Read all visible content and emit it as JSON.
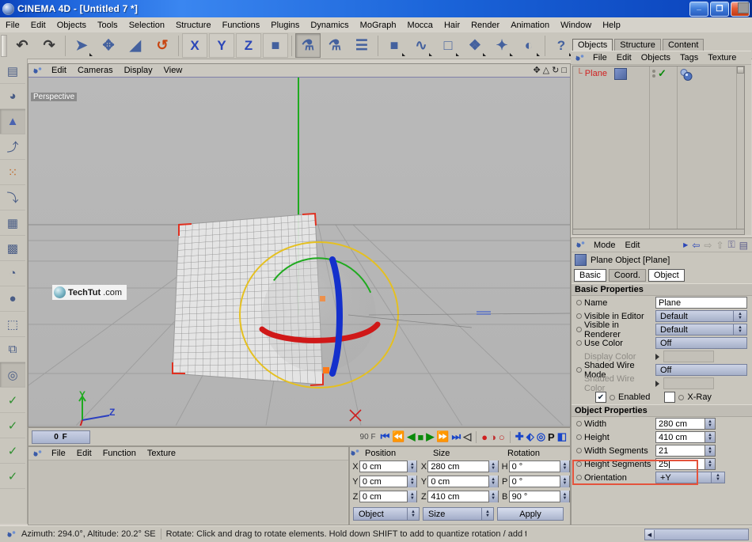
{
  "window": {
    "title": "CINEMA 4D - [Untitled 7 *]",
    "app_icon": "c4d-sphere-icon",
    "minimize": "_",
    "maximize": "❐",
    "close": "✕"
  },
  "menubar": {
    "items": [
      "File",
      "Edit",
      "Objects",
      "Tools",
      "Selection",
      "Structure",
      "Functions",
      "Plugins",
      "Dynamics",
      "MoGraph",
      "Mocca",
      "Hair",
      "Render",
      "Animation",
      "Window",
      "Help"
    ]
  },
  "toolbar": {
    "buttons": [
      {
        "name": "undo-icon",
        "glyph": "↶"
      },
      {
        "name": "redo-icon",
        "glyph": "↷"
      },
      {
        "name": "select-tool-icon",
        "glyph": "➤"
      },
      {
        "name": "move-tool-icon",
        "glyph": "✥"
      },
      {
        "name": "scale-tool-icon",
        "glyph": "◢"
      },
      {
        "name": "rotate-tool-icon",
        "glyph": "↺"
      },
      {
        "name": "x-axis-lock-icon",
        "glyph": "X"
      },
      {
        "name": "y-axis-lock-icon",
        "glyph": "Y"
      },
      {
        "name": "z-axis-lock-icon",
        "glyph": "Z"
      },
      {
        "name": "world-object-coords-icon",
        "glyph": "■"
      },
      {
        "name": "render-view-icon",
        "glyph": "⚗"
      },
      {
        "name": "render-region-icon",
        "glyph": "⚗"
      },
      {
        "name": "render-settings-icon",
        "glyph": "☰"
      },
      {
        "name": "add-cube-primitive-icon",
        "glyph": "■"
      },
      {
        "name": "add-spline-icon",
        "glyph": "∿"
      },
      {
        "name": "add-hypernurbs-icon",
        "glyph": "□"
      },
      {
        "name": "add-array-icon",
        "glyph": "❖"
      },
      {
        "name": "add-deformer-icon",
        "glyph": "✦"
      },
      {
        "name": "add-light-icon",
        "glyph": "◐"
      },
      {
        "name": "help-cursor-icon",
        "glyph": "?"
      },
      {
        "name": "script-help-icon",
        "glyph": "?"
      }
    ]
  },
  "left_toolbar": {
    "buttons": [
      {
        "name": "layout-manager-icon",
        "glyph": "▤"
      },
      {
        "name": "object-axis-modes-icon",
        "glyph": "◕"
      },
      {
        "name": "model-mode-icon",
        "glyph": "▲"
      },
      {
        "name": "object-axis-icon",
        "glyph": "⤴"
      },
      {
        "name": "point-mode-icon",
        "glyph": "⁙"
      },
      {
        "name": "edge-mode-icon",
        "glyph": "⤵"
      },
      {
        "name": "polygon-mode-icon",
        "glyph": "▦"
      },
      {
        "name": "texture-mode-icon",
        "glyph": "▩"
      },
      {
        "name": "texture-axis-icon",
        "glyph": "◔"
      },
      {
        "name": "viewport-solo-icon",
        "glyph": "●"
      },
      {
        "name": "enable-axis-icon",
        "glyph": "⬚"
      },
      {
        "name": "animation-lock-icon",
        "glyph": "⧉"
      },
      {
        "name": "uv-tools-icon",
        "glyph": "◎"
      },
      {
        "name": "quantize-toggle-icon",
        "glyph": "✓"
      },
      {
        "name": "texture-lock-icon",
        "glyph": "✓"
      },
      {
        "name": "viewport-clip-icon",
        "glyph": "✓"
      },
      {
        "name": "particle-toggle-icon",
        "glyph": "✓"
      }
    ]
  },
  "viewport": {
    "menu": [
      "Edit",
      "Cameras",
      "Display",
      "View"
    ],
    "label": "Perspective",
    "corner_icons": [
      {
        "name": "pan-view-icon",
        "glyph": "✥"
      },
      {
        "name": "zoom-view-icon",
        "glyph": "△"
      },
      {
        "name": "rotate-view-icon",
        "glyph": "↻"
      },
      {
        "name": "maximize-view-icon",
        "glyph": "□"
      }
    ],
    "axis_gizmo": {
      "y": "Y",
      "z": "Z",
      "x": "X"
    },
    "watermark": {
      "logo": "T",
      "name": "TechTut",
      "suffix": ".com"
    }
  },
  "timeline": {
    "current_frame": "0 F",
    "end_frame": "90 F",
    "controls": [
      {
        "name": "go-to-start-button",
        "glyph": "⏮"
      },
      {
        "name": "previous-key-button",
        "glyph": "⏪"
      },
      {
        "name": "play-reverse-button",
        "glyph": "◀"
      },
      {
        "name": "stop-button",
        "glyph": "■"
      },
      {
        "name": "play-forward-button",
        "glyph": "▶"
      },
      {
        "name": "next-key-button",
        "glyph": "⏩"
      },
      {
        "name": "go-to-end-button",
        "glyph": "⏭"
      },
      {
        "name": "sound-toggle-button",
        "glyph": "◁"
      },
      {
        "name": "record-button",
        "glyph": "●"
      },
      {
        "name": "autokey-button",
        "glyph": "◑"
      },
      {
        "name": "keyframe-selection-button",
        "glyph": "○"
      },
      {
        "name": "record-position-button",
        "glyph": "✚"
      },
      {
        "name": "record-scale-button",
        "glyph": "⬖"
      },
      {
        "name": "record-rotation-button",
        "glyph": "◎"
      },
      {
        "name": "record-pla-button",
        "glyph": "P"
      },
      {
        "name": "record-parameter-button",
        "glyph": "◧"
      }
    ]
  },
  "material_manager": {
    "menu": [
      "File",
      "Edit",
      "Function",
      "Texture"
    ],
    "materials": []
  },
  "coordinate_manager": {
    "headers": {
      "position": "Position",
      "size": "Size",
      "rotation": "Rotation"
    },
    "position": [
      {
        "axis": "X",
        "value": "0 cm"
      },
      {
        "axis": "Y",
        "value": "0 cm"
      },
      {
        "axis": "Z",
        "value": "0 cm"
      }
    ],
    "size": [
      {
        "axis": "X",
        "value": "280 cm"
      },
      {
        "axis": "Y",
        "value": "0 cm"
      },
      {
        "axis": "Z",
        "value": "410 cm"
      }
    ],
    "rotation": [
      {
        "axis": "H",
        "value": "0 °"
      },
      {
        "axis": "P",
        "value": "0 °"
      },
      {
        "axis": "B",
        "value": "90 °"
      }
    ],
    "mode_left": "Object",
    "mode_mid": "Size",
    "apply_label": "Apply"
  },
  "object_manager": {
    "tabs": [
      {
        "label": "Objects",
        "active": true
      },
      {
        "label": "Structure",
        "active": false
      },
      {
        "label": "Content",
        "active": false
      }
    ],
    "menu": [
      "File",
      "Edit",
      "Objects",
      "Tags",
      "Texture"
    ],
    "rows": [
      {
        "name": "Plane",
        "visible_editor": "✓",
        "tag": "phong-tag-icon"
      }
    ]
  },
  "attribute_manager": {
    "menu": [
      "Mode",
      "Edit"
    ],
    "nav_icons": [
      {
        "name": "history-forward-icon",
        "glyph": "▶"
      },
      {
        "name": "history-back-icon",
        "glyph": "⇦"
      },
      {
        "name": "history-next-icon",
        "glyph": "⇨"
      },
      {
        "name": "go-up-icon",
        "glyph": "⇧"
      },
      {
        "name": "lock-icon",
        "glyph": "⚿"
      },
      {
        "name": "panel-layout-icon",
        "glyph": "▤"
      }
    ],
    "object_title": "Plane Object [Plane]",
    "tabs": [
      {
        "label": "Basic",
        "active": true
      },
      {
        "label": "Coord.",
        "active": false
      },
      {
        "label": "Object",
        "active": true
      }
    ],
    "basic_section": "Basic Properties",
    "basic_rows": [
      {
        "label": "Name",
        "type": "text",
        "value": "Plane",
        "dim": false
      },
      {
        "label": "Visible in Editor",
        "type": "combo",
        "value": "Default",
        "dim": false
      },
      {
        "label": "Visible in Renderer",
        "type": "combo",
        "value": "Default",
        "dim": false
      },
      {
        "label": "Use Color",
        "type": "flat",
        "value": "Off",
        "dim": false
      },
      {
        "label": "Display Color",
        "type": "grey",
        "value": "",
        "dim": true
      },
      {
        "label": "Shaded Wire Mode",
        "type": "flat",
        "value": "Off",
        "dim": false
      },
      {
        "label": "Shaded Wire Color",
        "type": "grey",
        "value": "",
        "dim": true
      }
    ],
    "checkboxes": [
      {
        "label": "Enabled",
        "checked": true
      },
      {
        "label": "X-Ray",
        "checked": false
      }
    ],
    "object_section": "Object Properties",
    "object_rows": [
      {
        "label": "Width",
        "type": "num",
        "value": "280 cm",
        "highlighted": false
      },
      {
        "label": "Height",
        "type": "num",
        "value": "410 cm",
        "highlighted": false
      },
      {
        "label": "Width Segments",
        "type": "num",
        "value": "21",
        "highlighted": true
      },
      {
        "label": "Height Segments",
        "type": "num",
        "value": "25",
        "highlighted": true,
        "focused": true
      },
      {
        "label": "Orientation",
        "type": "combo",
        "value": "+Y",
        "highlighted": false
      }
    ],
    "highlight_color": "#e4533c"
  },
  "statusbar": {
    "camera_info": "Azimuth: 294.0°, Altitude: 20.2°  SE",
    "hint": "Rotate: Click and drag to rotate elements. Hold down SHIFT to add to quantize rotation / add to the selection in p",
    "progress_arrow": "◀"
  }
}
